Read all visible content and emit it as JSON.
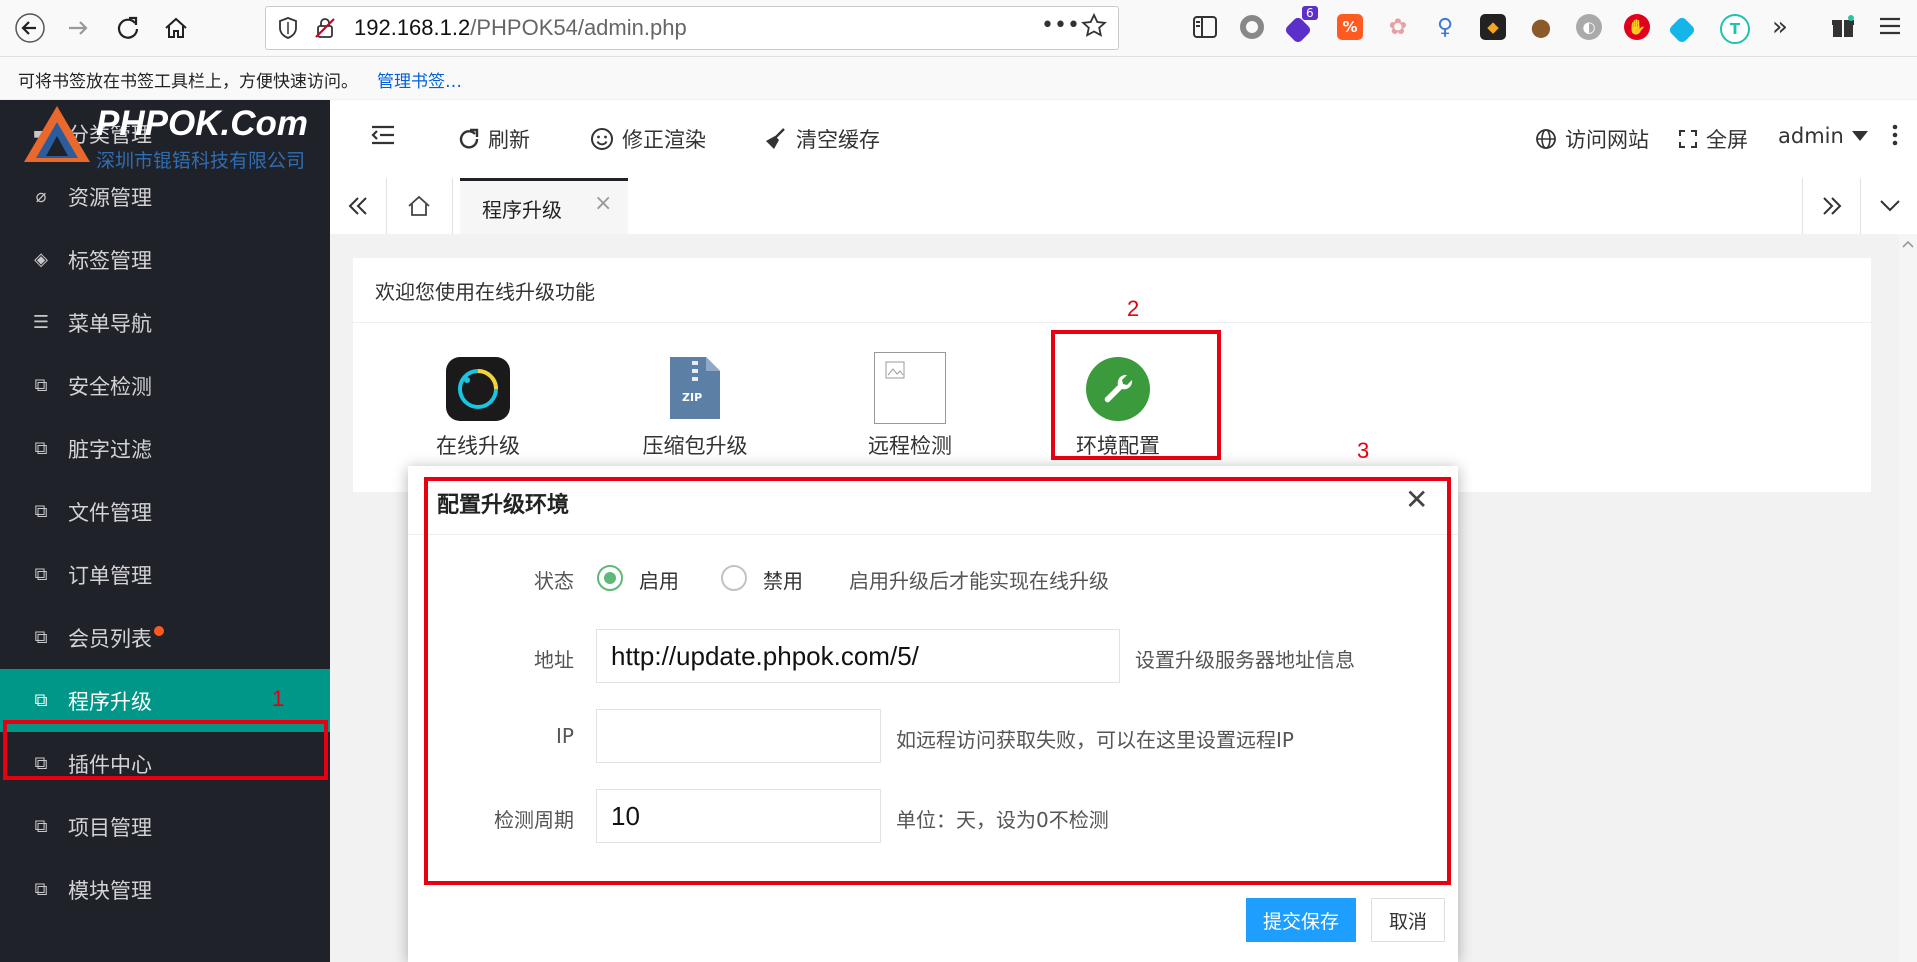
{
  "browser": {
    "url_host": "192.168.1.2",
    "url_path": "/PHPOK54/admin.php",
    "url_dots": "•••",
    "bookmarks_hint": "可将书签放在书签工具栏上，方便快速访问。",
    "bookmarks_link": "管理书签…",
    "ext_badge": "6"
  },
  "logo": {
    "title": "PHPOK.Com",
    "subtitle": "深圳市锟铻科技有限公司"
  },
  "sidebar": {
    "items": [
      {
        "label": "分类管理"
      },
      {
        "label": "资源管理"
      },
      {
        "label": "标签管理"
      },
      {
        "label": "菜单导航"
      },
      {
        "label": "安全检测"
      },
      {
        "label": "脏字过滤"
      },
      {
        "label": "文件管理"
      },
      {
        "label": "订单管理"
      },
      {
        "label": "会员列表"
      },
      {
        "label": "程序升级"
      },
      {
        "label": "插件中心"
      },
      {
        "label": "项目管理"
      },
      {
        "label": "模块管理"
      }
    ]
  },
  "header": {
    "refresh": "刷新",
    "fix_render": "修正渲染",
    "clear_cache": "清空缓存",
    "visit_site": "访问网站",
    "fullscreen": "全屏",
    "user": "admin"
  },
  "tabs": {
    "active_label": "程序升级",
    "close": "×"
  },
  "panel": {
    "title": "欢迎您使用在线升级功能",
    "tools": [
      {
        "label": "在线升级"
      },
      {
        "label": "压缩包升级"
      },
      {
        "label": "远程检测"
      },
      {
        "label": "环境配置"
      }
    ],
    "zip_text": "ZIP"
  },
  "dialog": {
    "title": "配置升级环境",
    "close": "✕",
    "status_label": "状态",
    "enable": "启用",
    "disable": "禁用",
    "status_hint": "启用升级后才能实现在线升级",
    "address_label": "地址",
    "address_value": "http://update.phpok.com/5/",
    "address_hint": "设置升级服务器地址信息",
    "ip_label": "IP",
    "ip_value": "",
    "ip_hint": "如远程访问获取失败，可以在这里设置远程IP",
    "period_label": "检测周期",
    "period_value": "10",
    "period_hint": "单位：天，设为0不检测",
    "submit": "提交保存",
    "cancel": "取消"
  },
  "annotations": {
    "one": "1",
    "two": "2",
    "three": "3"
  },
  "colors": {
    "accent": "#009688",
    "sidebar_bg": "#20222a",
    "primary_button": "#1E9FFF",
    "annotation": "#e60012",
    "radio_on": "#5FB878"
  }
}
